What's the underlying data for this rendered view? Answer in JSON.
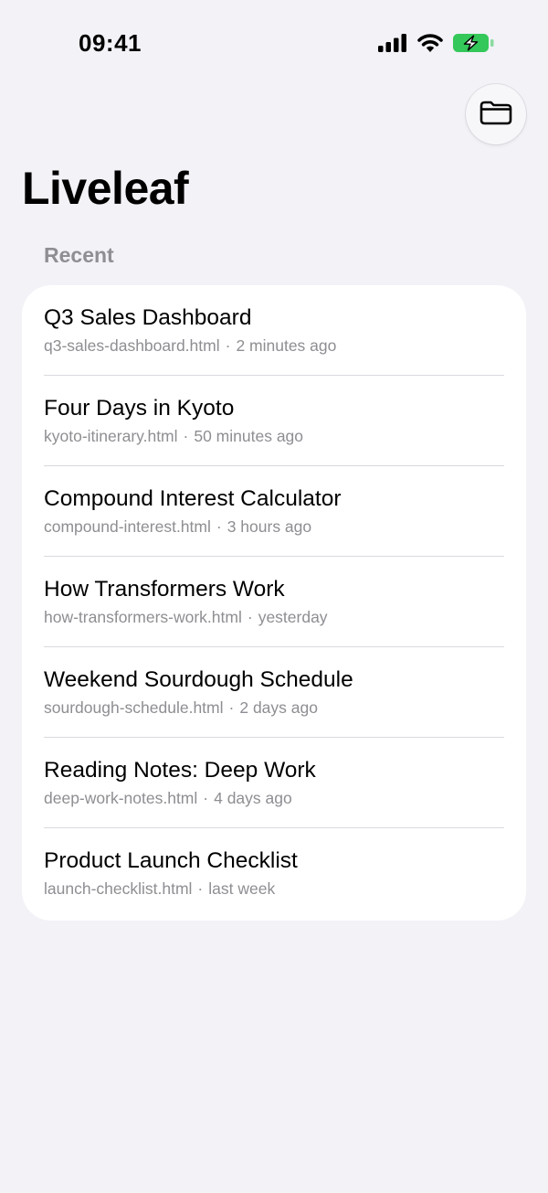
{
  "status_bar": {
    "time": "09:41",
    "icons": [
      "cellular-signal-icon",
      "wifi-icon",
      "battery-charging-icon"
    ],
    "battery_color": "#34C759"
  },
  "header": {
    "title": "Liveleaf",
    "folder_button_icon": "folder-icon"
  },
  "recent": {
    "section_label": "Recent",
    "separator": "·",
    "items": [
      {
        "title": "Q3 Sales Dashboard",
        "filename": "q3-sales-dashboard.html",
        "time": "2 minutes ago"
      },
      {
        "title": "Four Days in Kyoto",
        "filename": "kyoto-itinerary.html",
        "time": "50 minutes ago"
      },
      {
        "title": "Compound Interest Calculator",
        "filename": "compound-interest.html",
        "time": "3 hours ago"
      },
      {
        "title": "How Transformers Work",
        "filename": "how-transformers-work.html",
        "time": "yesterday"
      },
      {
        "title": "Weekend Sourdough Schedule",
        "filename": "sourdough-schedule.html",
        "time": "2 days ago"
      },
      {
        "title": "Reading Notes: Deep Work",
        "filename": "deep-work-notes.html",
        "time": "4 days ago"
      },
      {
        "title": "Product Launch Checklist",
        "filename": "launch-checklist.html",
        "time": "last week"
      }
    ]
  }
}
